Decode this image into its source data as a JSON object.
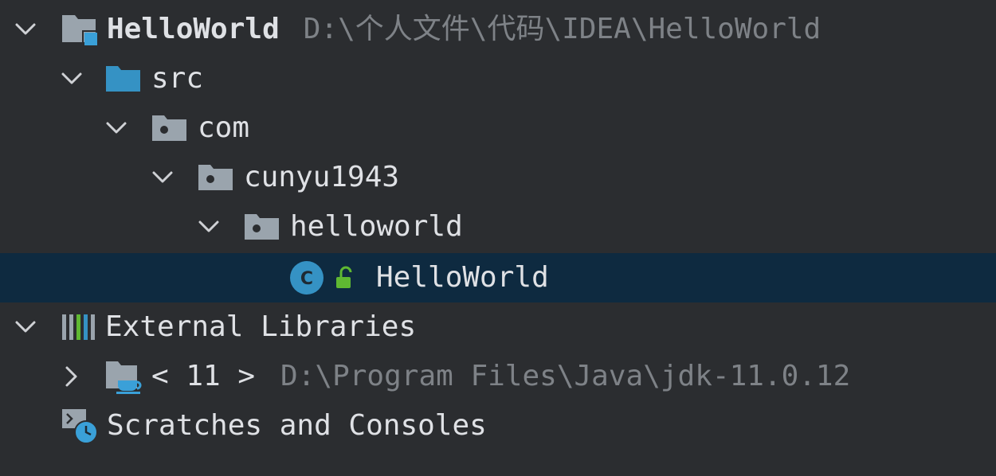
{
  "project_tree": {
    "project": {
      "name": "HelloWorld",
      "path": "D:\\个人文件\\代码\\IDEA\\HelloWorld",
      "expanded": true
    },
    "src": {
      "name": "src",
      "expanded": true
    },
    "pkg_com": {
      "name": "com",
      "expanded": true
    },
    "pkg_cunyu": {
      "name": "cunyu1943",
      "expanded": true
    },
    "pkg_helloworld": {
      "name": "helloworld",
      "expanded": true
    },
    "class_file": {
      "name": "HelloWorld",
      "selected": true,
      "class_icon_letter": "C",
      "access": "public"
    },
    "external_libraries": {
      "name": "External Libraries",
      "expanded": true
    },
    "jdk": {
      "name": "< 11 >",
      "path": "D:\\Program Files\\Java\\jdk-11.0.12",
      "expanded": false
    },
    "scratches": {
      "name": "Scratches and Consoles"
    }
  },
  "colors": {
    "background": "#2b2d30",
    "selection": "#0e2a40",
    "text": "#dfe1e5",
    "path_text": "#7e8287",
    "folder_gray": "#9aa4ad",
    "source_folder_blue": "#3592c4",
    "class_icon_blue": "#3592c4",
    "access_green": "#5fb832"
  },
  "icons": {
    "chevron_expanded": "chevron-down-icon",
    "chevron_collapsed": "chevron-right-icon",
    "project": "project-folder-icon",
    "source_folder": "source-folder-icon",
    "package": "package-icon",
    "class": "class-icon",
    "access": "unlock-icon",
    "libraries": "libraries-icon",
    "jdk": "jdk-folder-icon",
    "scratches": "scratches-icon"
  }
}
